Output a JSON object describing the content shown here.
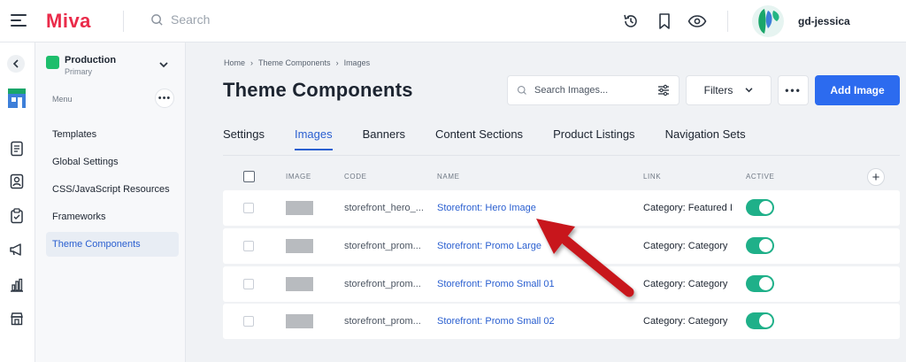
{
  "brand": {
    "name": "Miva",
    "color": "#ea2b4a",
    "accent": "#2c6bef",
    "toggle_on": "#1fb089",
    "annotation_arrow": "#c8171d"
  },
  "header": {
    "search_placeholder": "Search",
    "icons": [
      "history-icon",
      "bookmark-icon",
      "eye-icon"
    ],
    "username": "gd-jessica"
  },
  "rail": {
    "icons": [
      "store-icon",
      "orders-icon",
      "customers-icon",
      "clipboard-icon",
      "marketing-icon",
      "reports-icon",
      "shop-icon"
    ]
  },
  "store": {
    "name": "Production",
    "subtitle": "Primary"
  },
  "menu": {
    "label": "Menu",
    "items": [
      {
        "label": "Templates",
        "active": false
      },
      {
        "label": "Global Settings",
        "active": false
      },
      {
        "label": "CSS/JavaScript Resources",
        "active": false
      },
      {
        "label": "Frameworks",
        "active": false
      },
      {
        "label": "Theme Components",
        "active": true
      }
    ]
  },
  "breadcrumb": [
    "Home",
    "Theme Components",
    "Images"
  ],
  "page": {
    "title": "Theme Components",
    "search_placeholder": "Search Images...",
    "filters_label": "Filters",
    "add_label": "Add Image"
  },
  "tabs": [
    {
      "label": "Settings",
      "active": false
    },
    {
      "label": "Images",
      "active": true
    },
    {
      "label": "Banners",
      "active": false
    },
    {
      "label": "Content Sections",
      "active": false
    },
    {
      "label": "Product Listings",
      "active": false
    },
    {
      "label": "Navigation Sets",
      "active": false
    }
  ],
  "table": {
    "columns": {
      "image": "IMAGE",
      "code": "CODE",
      "name": "NAME",
      "link": "LINK",
      "active": "ACTIVE"
    },
    "rows": [
      {
        "code": "storefront_hero_...",
        "name": "Storefront: Hero Image",
        "link": "Category: Featured I",
        "active": true
      },
      {
        "code": "storefront_prom...",
        "name": "Storefront: Promo Large",
        "link": "Category: Category",
        "active": true
      },
      {
        "code": "storefront_prom...",
        "name": "Storefront: Promo Small 01",
        "link": "Category: Category",
        "active": true
      },
      {
        "code": "storefront_prom...",
        "name": "Storefront: Promo Small 02",
        "link": "Category: Category",
        "active": true
      }
    ]
  }
}
